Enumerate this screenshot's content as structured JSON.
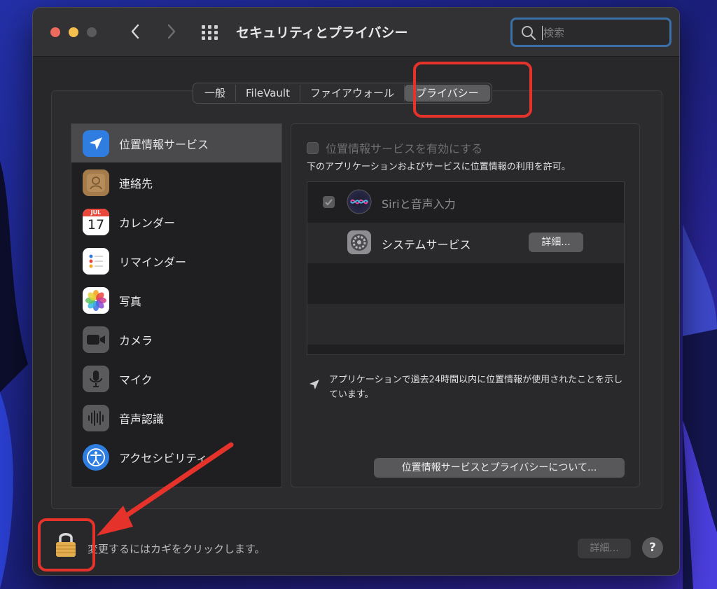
{
  "window": {
    "title": "セキュリティとプライバシー"
  },
  "search": {
    "placeholder": "検索"
  },
  "tabs": [
    {
      "label": "一般"
    },
    {
      "label": "FileVault"
    },
    {
      "label": "ファイアウォール"
    },
    {
      "label": "プライバシー",
      "active": true
    }
  ],
  "sidebar": {
    "items": [
      {
        "label": "位置情報サービス",
        "icon": "location-arrow-icon",
        "active": true
      },
      {
        "label": "連絡先",
        "icon": "contacts-icon"
      },
      {
        "label": "カレンダー",
        "icon": "calendar-icon",
        "calendar_month": "JUL",
        "calendar_day": "17"
      },
      {
        "label": "リマインダー",
        "icon": "reminders-icon"
      },
      {
        "label": "写真",
        "icon": "photos-icon"
      },
      {
        "label": "カメラ",
        "icon": "camera-icon"
      },
      {
        "label": "マイク",
        "icon": "microphone-icon"
      },
      {
        "label": "音声認識",
        "icon": "speech-recognition-icon"
      },
      {
        "label": "アクセシビリティ",
        "icon": "accessibility-icon"
      }
    ]
  },
  "location_panel": {
    "enable_label": "位置情報サービスを有効にする",
    "enable_checked": false,
    "allow_description": "下のアプリケーションおよびサービスに位置情報の利用を許可。",
    "apps": [
      {
        "label": "Siriと音声入力",
        "checked": true,
        "enabled": false,
        "icon": "siri-icon"
      },
      {
        "label": "システムサービス",
        "details_label": "詳細...",
        "icon": "system-services-icon"
      }
    ],
    "notice": "アプリケーションで過去24時間以内に位置情報が使用されたことを示しています。",
    "about_button": "位置情報サービスとプライバシーについて..."
  },
  "footer": {
    "lock_label": "変更するにはカギをクリックします。",
    "details_label": "詳細...",
    "help_label": "?"
  },
  "colors": {
    "annotation": "#e5322b",
    "accent_blue": "#2f7de1",
    "search_focus": "#3b6fa8"
  }
}
